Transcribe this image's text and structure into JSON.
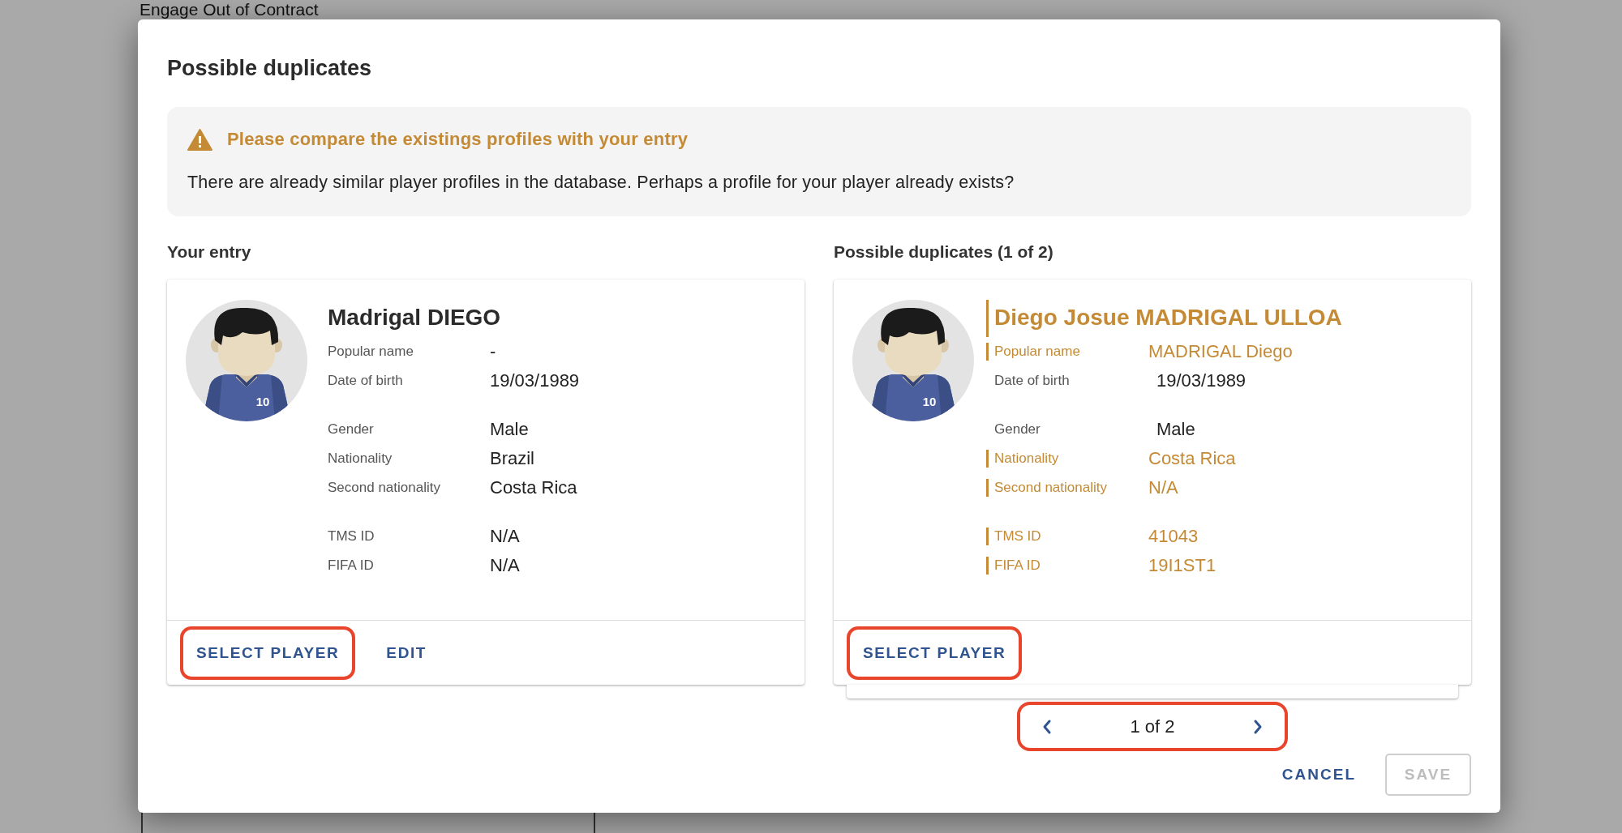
{
  "page": {
    "title": "Engage Out of Contract"
  },
  "dialog": {
    "title": "Possible duplicates",
    "alert": {
      "heading": "Please compare the existings profiles with your entry",
      "message": "There are already similar player profiles in the database. Perhaps a profile for your player already exists?"
    },
    "entry": {
      "heading": "Your entry",
      "card": {
        "name": "Madrigal DIEGO",
        "name_differs": false,
        "jersey_number": "10",
        "groups": [
          [
            {
              "label": "Popular name",
              "value": "-",
              "differs": false
            },
            {
              "label": "Date of birth",
              "value": "19/03/1989",
              "differs": false
            }
          ],
          [
            {
              "label": "Gender",
              "value": "Male",
              "differs": false
            },
            {
              "label": "Nationality",
              "value": "Brazil",
              "differs": false
            },
            {
              "label": "Second nationality",
              "value": "Costa Rica",
              "differs": false
            }
          ],
          [
            {
              "label": "TMS ID",
              "value": "N/A",
              "differs": false
            },
            {
              "label": "FIFA ID",
              "value": "N/A",
              "differs": false
            }
          ]
        ],
        "buttons": [
          {
            "label": "SELECT PLAYER",
            "highlighted": true
          },
          {
            "label": "EDIT",
            "highlighted": false
          }
        ]
      }
    },
    "duplicates": {
      "heading": "Possible duplicates (1 of 2)",
      "card": {
        "name": "Diego Josue MADRIGAL ULLOA",
        "name_differs": true,
        "jersey_number": "10",
        "groups": [
          [
            {
              "label": "Popular name",
              "value": "MADRIGAL Diego",
              "differs": true
            },
            {
              "label": "Date of birth",
              "value": "19/03/1989",
              "differs": false
            }
          ],
          [
            {
              "label": "Gender",
              "value": "Male",
              "differs": false
            },
            {
              "label": "Nationality",
              "value": "Costa Rica",
              "differs": true
            },
            {
              "label": "Second nationality",
              "value": "N/A",
              "differs": true
            }
          ],
          [
            {
              "label": "TMS ID",
              "value": "41043",
              "differs": true
            },
            {
              "label": "FIFA ID",
              "value": "19I1ST1",
              "differs": true
            }
          ]
        ],
        "buttons": [
          {
            "label": "SELECT PLAYER",
            "highlighted": true
          }
        ]
      },
      "pager": {
        "text": "1 of 2",
        "highlighted": true
      }
    },
    "actions": [
      {
        "label": "CANCEL",
        "kind": "text",
        "disabled": false
      },
      {
        "label": "SAVE",
        "kind": "outlined",
        "disabled": true
      }
    ]
  }
}
